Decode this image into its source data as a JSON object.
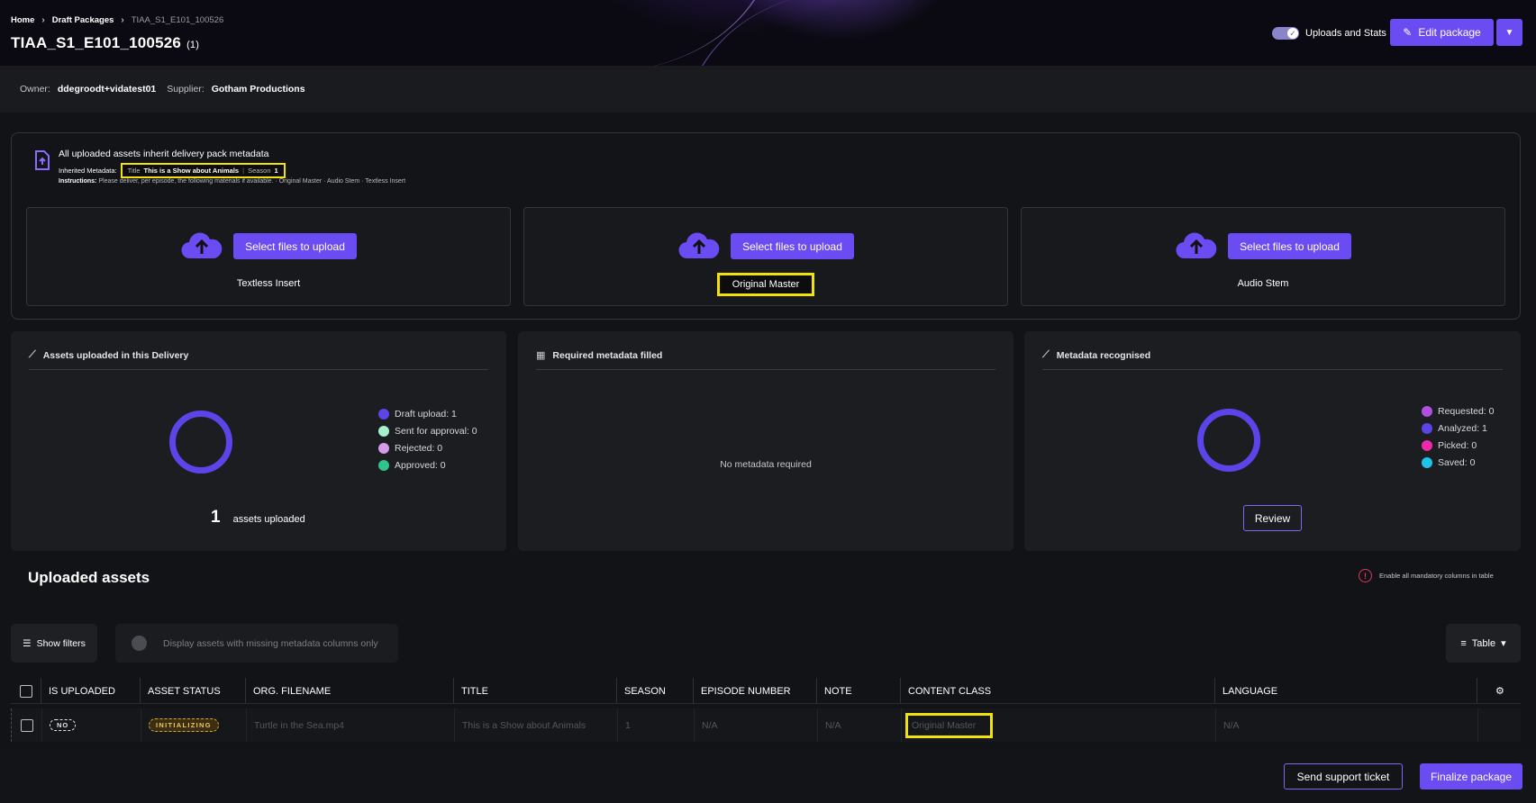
{
  "breadcrumb": {
    "home": "Home",
    "draft": "Draft Packages",
    "current": "TIAA_S1_E101_100526"
  },
  "header": {
    "title": "TIAA_S1_E101_100526",
    "count": "(1)",
    "toggle_label": "Uploads and Stats",
    "edit_label": "Edit package"
  },
  "owner_bar": {
    "owner_label": "Owner:",
    "owner_value": "ddegroodt+vidatest01",
    "supplier_label": "Supplier:",
    "supplier_value": "Gotham Productions"
  },
  "upload": {
    "notice": "All uploaded assets inherit delivery pack metadata",
    "inherited_label": "Inherited Metadata:",
    "title_label": "Title",
    "title_value": "This is a Show about Animals",
    "season_label": "Season",
    "season_value": "1",
    "instructions_label": "Instructions:",
    "instructions_text": "Please deliver, per episode, the following materials if available. · Original Master · Audio Stem · Textless Insert",
    "cards": [
      {
        "button": "Select files to upload",
        "label": "Textless Insert"
      },
      {
        "button": "Select files to upload",
        "label": "Original Master"
      },
      {
        "button": "Select files to upload",
        "label": "Audio Stem"
      }
    ]
  },
  "stats": {
    "assets": {
      "title": "Assets uploaded in this Delivery",
      "legend": [
        "Draft upload: 1",
        "Sent for approval: 0",
        "Rejected: 0",
        "Approved: 0"
      ],
      "count": "1",
      "count_label": "assets uploaded"
    },
    "required": {
      "title": "Required metadata filled",
      "empty": "No metadata required"
    },
    "recognised": {
      "title": "Metadata recognised",
      "legend": [
        "Requested: 0",
        "Analyzed: 1",
        "Picked: 0",
        "Saved: 0"
      ],
      "review": "Review"
    }
  },
  "colors": {
    "accent": "#6a4cf2",
    "draft": "#5b45e9",
    "sent": "#a6f0cd",
    "rejected": "#d59ae8",
    "approved": "#2fc48c",
    "requested": "#b14fe0",
    "analyzed": "#5b45e9",
    "picked": "#ee2aa8",
    "saved": "#1ec5e8"
  },
  "assets_section": {
    "title": "Uploaded assets",
    "mandatory_note": "Enable all mandatory columns in table",
    "show_filters": "Show filters",
    "missing_only": "Display assets with missing metadata columns only",
    "view": "Table"
  },
  "table": {
    "columns": [
      "IS UPLOADED",
      "ASSET STATUS",
      "ORG. FILENAME",
      "TITLE",
      "SEASON",
      "EPISODE NUMBER",
      "NOTE",
      "CONTENT CLASS",
      "LANGUAGE"
    ],
    "rows": [
      {
        "is_uploaded": "NO",
        "status": "INITIALIZING",
        "filename": "Turtle in the Sea.mp4",
        "title": "This is a Show about Animals",
        "season": "1",
        "episode": "N/A",
        "note": "N/A",
        "content_class": "Original Master",
        "language": "N/A"
      }
    ]
  },
  "footer": {
    "support": "Send support ticket",
    "finalize": "Finalize package"
  }
}
